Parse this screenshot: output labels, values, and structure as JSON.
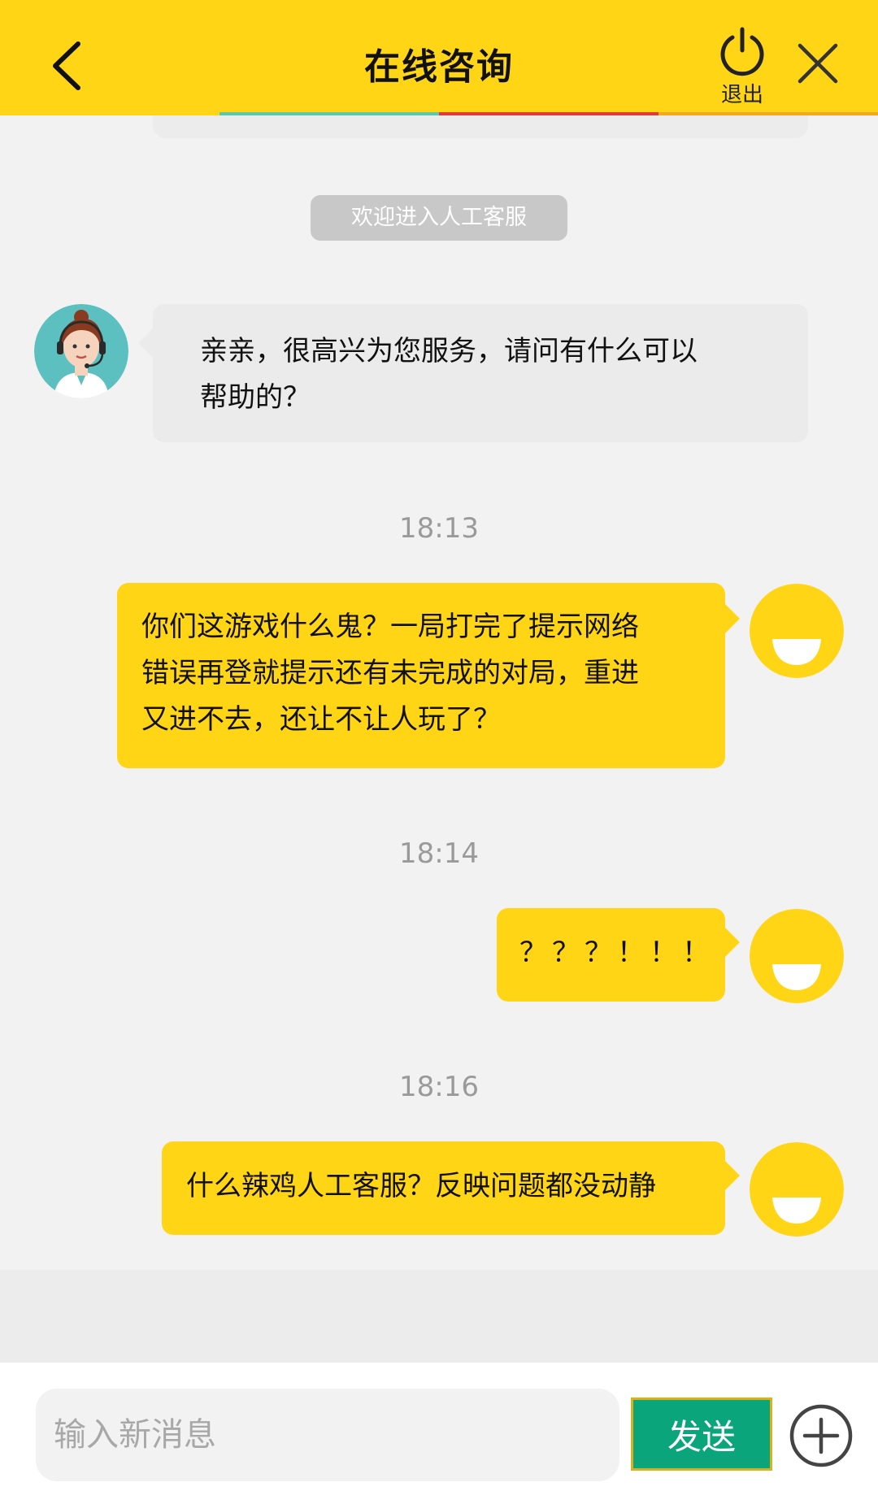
{
  "header": {
    "title": "在线咨询",
    "exit_label": "退出",
    "back_icon": "chevron-left-icon",
    "exit_icon": "power-icon",
    "close_icon": "close-icon",
    "background": "#ffd516",
    "strip_colors": [
      "#ffd516",
      "#5bc7b0",
      "#e23a3a",
      "#f5a623"
    ]
  },
  "chat": {
    "system_message": "欢迎进入人工客服",
    "messages": [
      {
        "from": "agent",
        "lines": [
          "亲亲，很高兴为您服务，请问有什么可以",
          "帮助的？"
        ]
      },
      {
        "time": "18:13"
      },
      {
        "from": "user",
        "lines": [
          "你们这游戏什么鬼？一局打完了提示网络",
          "错误再登就提示还有未完成的对局，重进",
          "又进不去，还让不让人玩了？"
        ]
      },
      {
        "time": "18:14"
      },
      {
        "from": "user",
        "lines": [
          "？？？！！！"
        ]
      },
      {
        "time": "18:16"
      },
      {
        "from": "user",
        "lines": [
          "什么辣鸡人工客服？反映问题都没动静"
        ]
      }
    ]
  },
  "composer": {
    "placeholder": "输入新消息",
    "send_label": "发送",
    "plus_icon": "plus-circle-icon",
    "send_color": "#0aa57a"
  }
}
